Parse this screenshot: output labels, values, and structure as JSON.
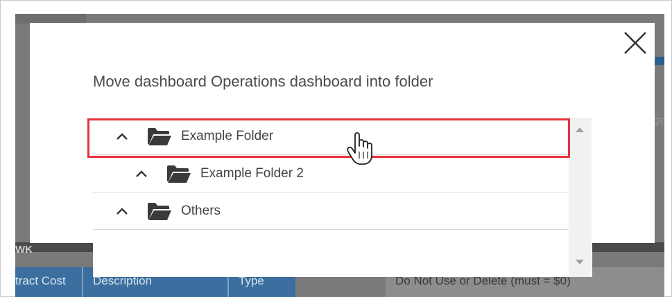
{
  "background": {
    "left_label": "WK",
    "table_headers": [
      "tract Cost",
      "Description",
      "Type"
    ],
    "note_text": "Do Not Use or Delete (must = $0)",
    "partial_digit": "20",
    "colors": {
      "header_blue": "#3c6e9f",
      "overlay_grey": "#7a7a7a"
    }
  },
  "modal": {
    "title": "Move dashboard Operations dashboard into folder",
    "close_icon": "close-icon",
    "folders": [
      {
        "label": "Example Folder",
        "icon": "folder-open-icon",
        "expand_icon": "chevron-up-icon",
        "highlighted": true
      },
      {
        "label": "Example Folder 2",
        "icon": "folder-open-icon",
        "expand_icon": "chevron-up-icon",
        "highlighted": false
      },
      {
        "label": "Others",
        "icon": "folder-open-icon",
        "expand_icon": "chevron-up-icon",
        "highlighted": false
      }
    ],
    "highlight_color": "#e6313b"
  },
  "cursor": {
    "icon": "hand-pointer-icon"
  }
}
